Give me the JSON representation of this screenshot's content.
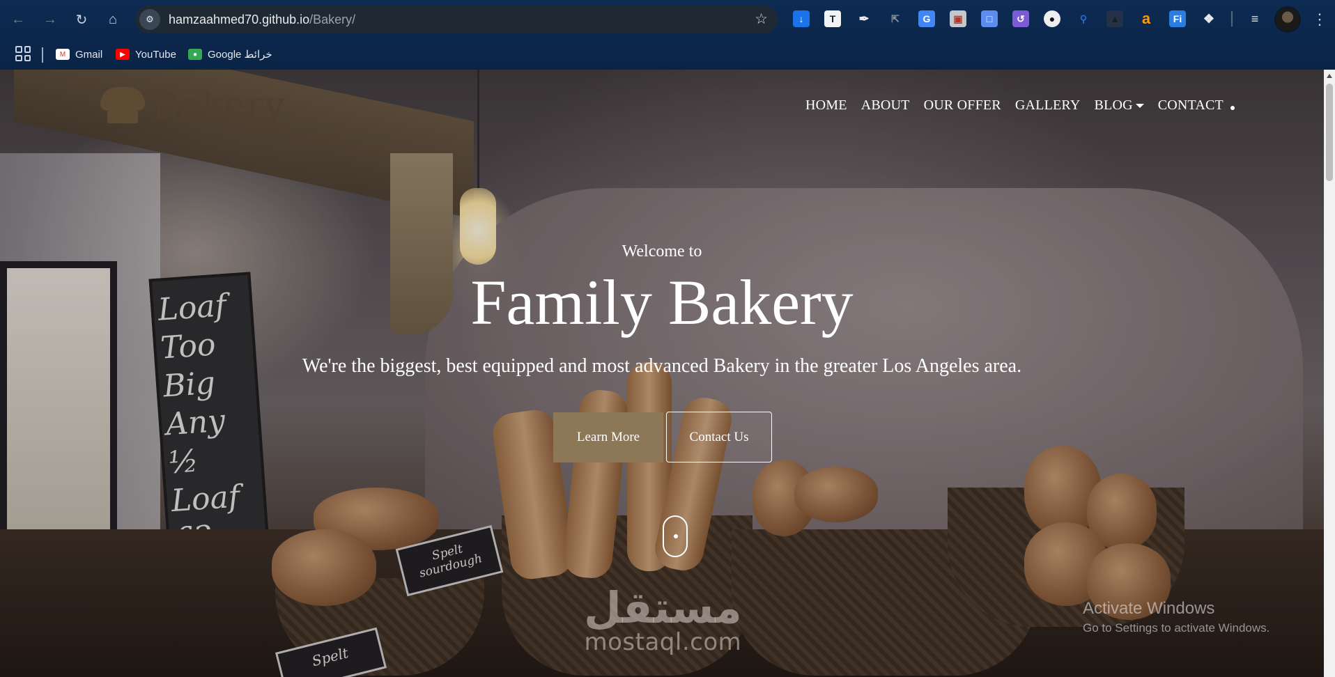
{
  "browser": {
    "url_host": "hamzaahmed70.github.io",
    "url_path": "/Bakery/",
    "bookmarks": [
      {
        "label": "Gmail",
        "icon": "gmail-icon",
        "color": "#d93025"
      },
      {
        "label": "YouTube",
        "icon": "youtube-icon",
        "color": "#ff0000"
      },
      {
        "label": "Google خرائط",
        "icon": "google-maps-icon",
        "color": "#34a853"
      }
    ]
  },
  "site": {
    "logo_text": "Bakery",
    "nav": [
      "HOME",
      "ABOUT",
      "OUR OFFER",
      "GALLERY",
      "BLOG",
      "CONTACT"
    ],
    "hero": {
      "kicker": "Welcome to",
      "title": "Family Bakery",
      "subtitle": "We're the biggest, best equipped and most advanced Bakery in the greater Los Angeles area.",
      "primary_button": "Learn More",
      "secondary_button": "Contact Us"
    },
    "accent_color": "#8c7757"
  },
  "scene_text": {
    "chalkboard": "Loaf Too Big Any ½ Loaf £2",
    "sign_1": "Spelt sourdough",
    "sign_2": "Spelt"
  },
  "watermarks": {
    "mostaql_ar": "مستقل",
    "mostaql_lat": "mostaql.com",
    "activate_title": "Activate Windows",
    "activate_sub": "Go to Settings to activate Windows."
  }
}
